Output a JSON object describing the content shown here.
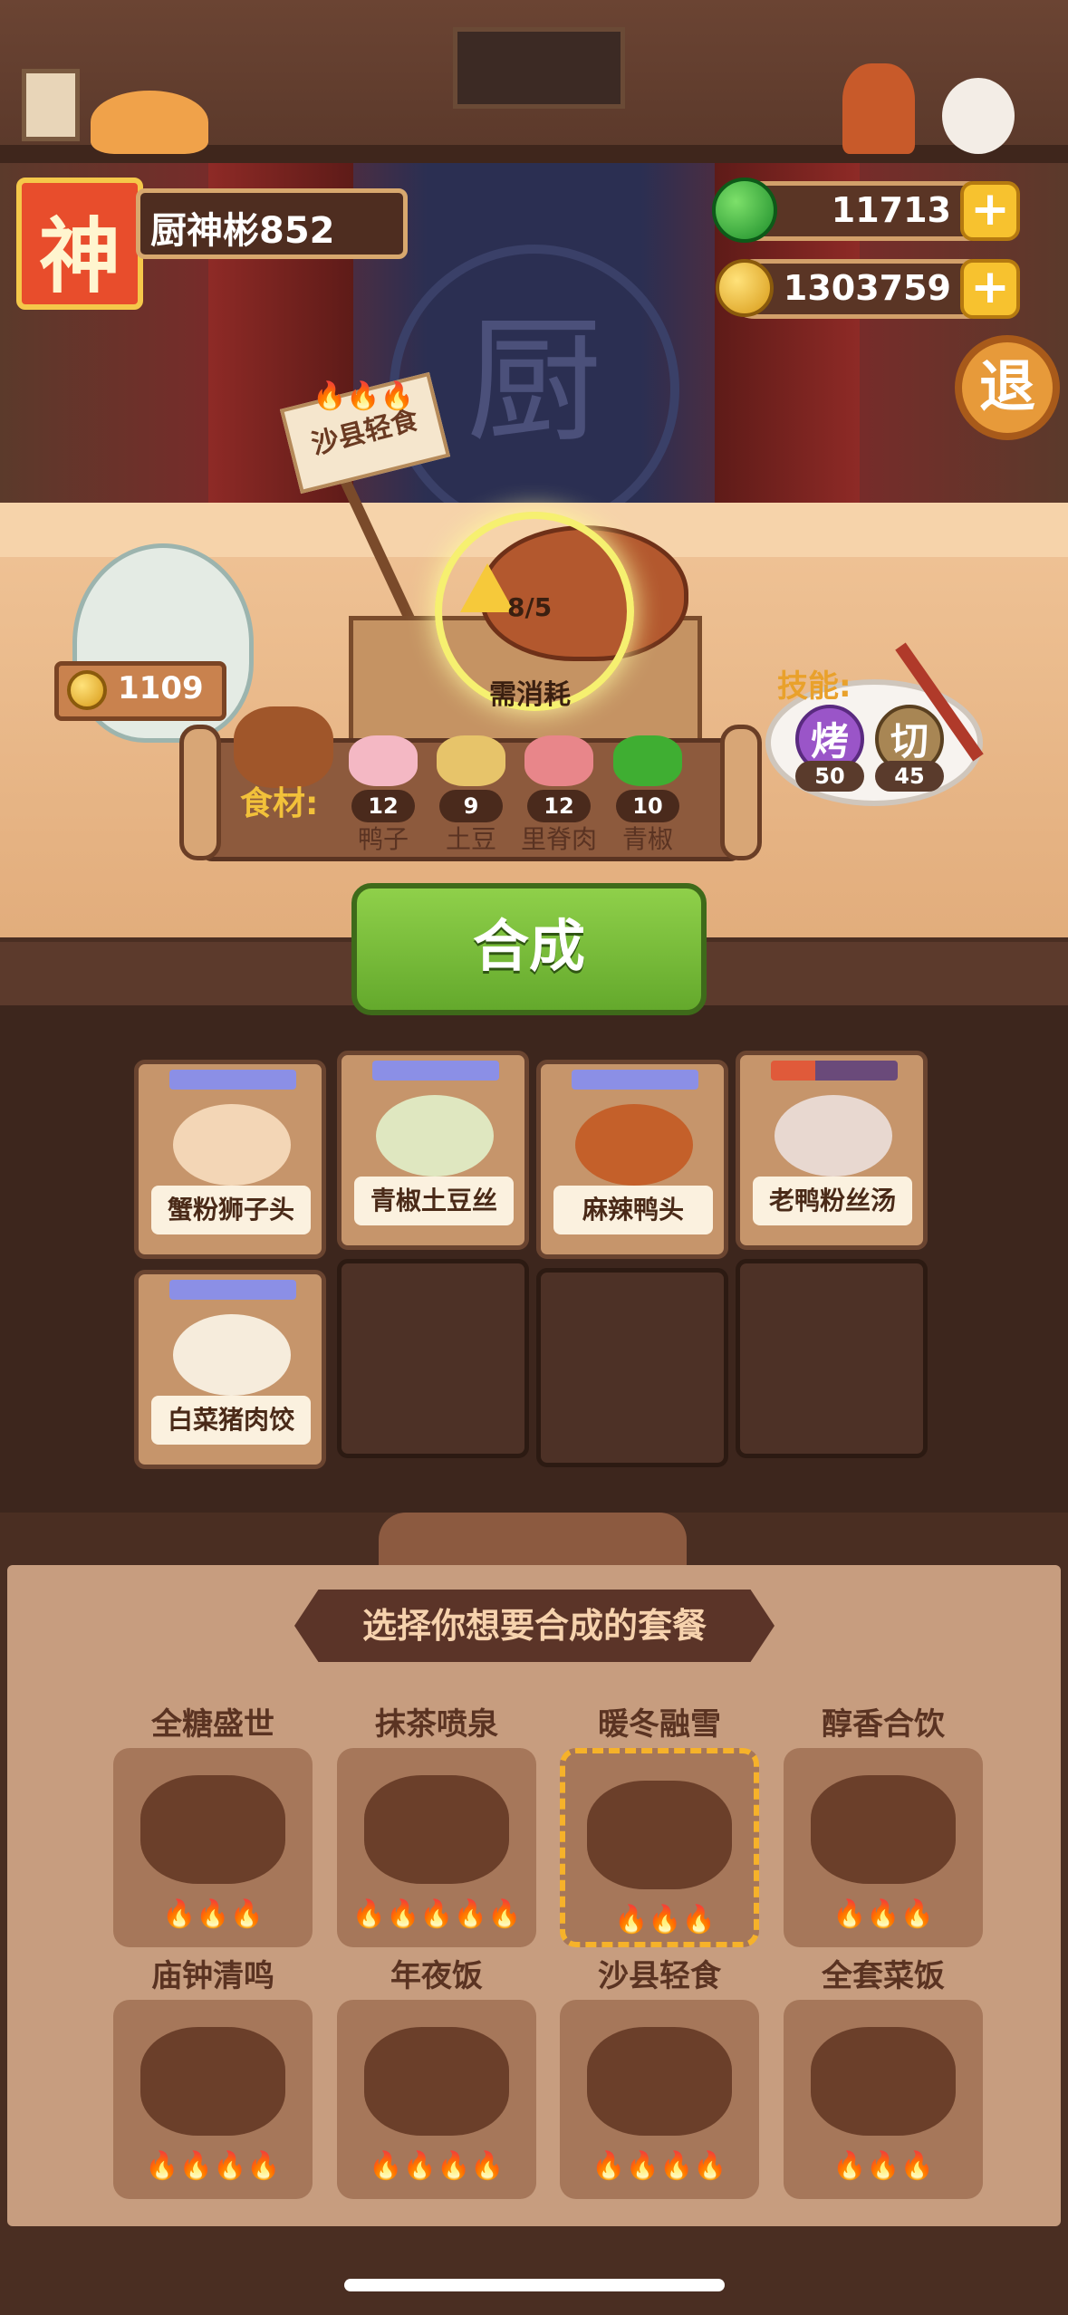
{
  "player": {
    "name": "厨神彬852",
    "avatar_char": "神"
  },
  "currency": {
    "jade": "11713",
    "coins": "1303759"
  },
  "exit_label": "退",
  "stage_logo": "厨",
  "recipe_sign": "沙县轻食",
  "jar_coins": "1109",
  "dish": {
    "count": "8/5",
    "consume_label": "需消耗"
  },
  "ingredients": {
    "label": "食材:",
    "items": [
      {
        "name": "鸭子",
        "count": "12"
      },
      {
        "name": "土豆",
        "count": "9"
      },
      {
        "name": "里脊肉",
        "count": "12"
      },
      {
        "name": "青椒",
        "count": "10"
      }
    ]
  },
  "skills": {
    "label": "技能:",
    "items": [
      {
        "char": "烤",
        "value": "50"
      },
      {
        "char": "切",
        "value": "45"
      }
    ]
  },
  "synth_button": "合成",
  "inventory": [
    {
      "name": "蟹粉狮子头"
    },
    {
      "name": "青椒土豆丝"
    },
    {
      "name": "麻辣鸭头"
    },
    {
      "name": "老鸭粉丝汤"
    },
    {
      "name": "白菜猪肉饺"
    }
  ],
  "panel": {
    "title": "选择你想要合成的套餐",
    "row0": [
      "全糖盛世",
      "抹茶喷泉",
      "暖冬融雪",
      "醇香合饮"
    ],
    "row1": [
      {
        "name": "庙钟清鸣",
        "flames": "🔥🔥🔥"
      },
      {
        "name": "年夜饭",
        "flames": "🔥🔥🔥🔥🔥"
      },
      {
        "name": "沙县轻食",
        "flames": "🔥🔥🔥",
        "selected": true
      },
      {
        "name": "全套菜饭",
        "flames": "🔥🔥🔥"
      }
    ],
    "row2": [
      {
        "flames": "🔥🔥🔥🔥"
      },
      {
        "flames": "🔥🔥🔥🔥"
      },
      {
        "flames": "🔥🔥🔥🔥"
      },
      {
        "flames": "🔥🔥🔥"
      }
    ]
  },
  "colors": {
    "accent_green": "#64a92c",
    "gold": "#f7c22f",
    "panel": "#c79d7f"
  }
}
